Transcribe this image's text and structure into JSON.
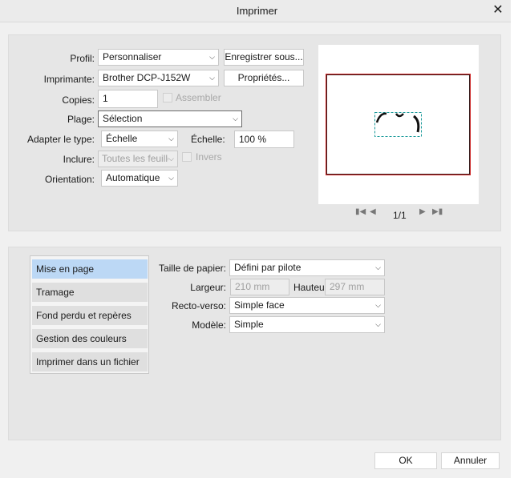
{
  "window": {
    "title": "Imprimer"
  },
  "settings": {
    "profil_label": "Profil:",
    "profil_value": "Personnaliser",
    "save_as_label": "Enregistrer sous...",
    "printer_label": "Imprimante:",
    "printer_value": "Brother DCP-J152W",
    "properties_label": "Propriétés...",
    "copies_label": "Copies:",
    "copies_value": "1",
    "collate_label": "Assembler",
    "range_label": "Plage:",
    "range_value": "Sélection",
    "fit_label": "Adapter le type:",
    "fit_value": "Échelle",
    "scale_label": "Échelle:",
    "scale_value": "100 %",
    "include_label": "Inclure:",
    "include_value": "Toutes les feuille",
    "invert_label": "Invers",
    "orientation_label": "Orientation:",
    "orientation_value": "Automatique"
  },
  "preview": {
    "page_indicator": "1/1"
  },
  "categories": [
    {
      "label": "Mise en page",
      "selected": true
    },
    {
      "label": "Tramage",
      "selected": false
    },
    {
      "label": "Fond perdu et repères",
      "selected": false
    },
    {
      "label": "Gestion des couleurs",
      "selected": false
    },
    {
      "label": "Imprimer dans un fichier",
      "selected": false
    }
  ],
  "layout": {
    "paper_size_label": "Taille de papier:",
    "paper_size_value": "Défini par pilote",
    "width_label": "Largeur:",
    "width_value": "210 mm",
    "height_label": "Hauteu",
    "height_value": "297 mm",
    "duplex_label": "Recto-verso:",
    "duplex_value": "Simple face",
    "model_label": "Modèle:",
    "model_value": "Simple"
  },
  "footer": {
    "ok_label": "OK",
    "cancel_label": "Annuler"
  },
  "colors": {
    "selected_category": "#bcd8f5",
    "preview_border": "#cc2222",
    "selection_outline": "#1a9a9a"
  }
}
